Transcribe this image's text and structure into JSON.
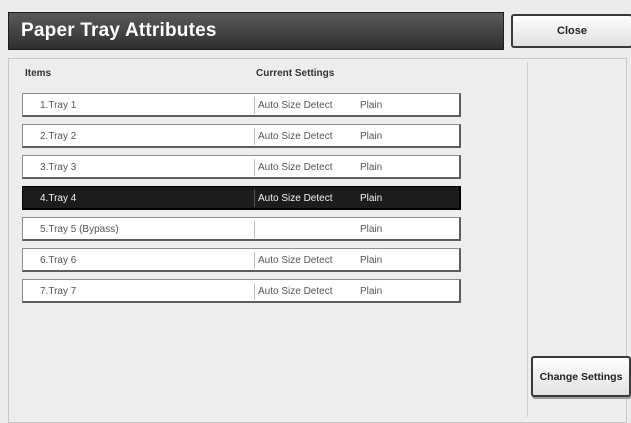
{
  "header": {
    "title": "Paper Tray Attributes",
    "close_label": "Close"
  },
  "table": {
    "columns": {
      "items": "Items",
      "current_settings": "Current Settings"
    },
    "rows": [
      {
        "item": "1.Tray 1",
        "size": "Auto Size Detect",
        "type": "Plain",
        "selected": false
      },
      {
        "item": "2.Tray 2",
        "size": "Auto Size Detect",
        "type": "Plain",
        "selected": false
      },
      {
        "item": "3.Tray 3",
        "size": "Auto Size Detect",
        "type": "Plain",
        "selected": false
      },
      {
        "item": "4.Tray 4",
        "size": "Auto Size Detect",
        "type": "Plain",
        "selected": true
      },
      {
        "item": "5.Tray 5 (Bypass)",
        "size": "",
        "type": "Plain",
        "selected": false
      },
      {
        "item": "6.Tray 6",
        "size": "Auto Size Detect",
        "type": "Plain",
        "selected": false
      },
      {
        "item": "7.Tray 7",
        "size": "Auto Size Detect",
        "type": "Plain",
        "selected": false
      }
    ]
  },
  "actions": {
    "change_settings_label": "Change Settings"
  }
}
